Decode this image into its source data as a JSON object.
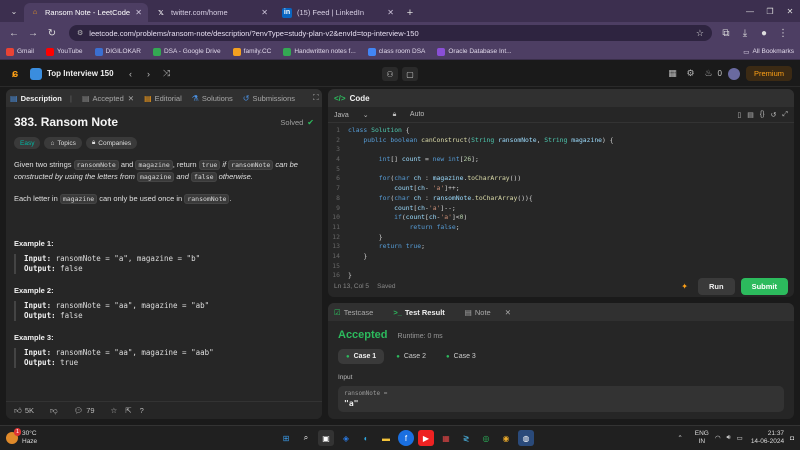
{
  "browser": {
    "tabs": [
      {
        "title": "Ransom Note - LeetCode",
        "favicon": "leetcode-icon",
        "active": true
      },
      {
        "title": "twitter.com/home",
        "favicon": "x-icon",
        "active": false
      },
      {
        "title": "(15) Feed | LinkedIn",
        "favicon": "linkedin-icon",
        "active": false
      }
    ],
    "url": "leetcode.com/problems/ransom-note/description/?envType=study-plan-v2&envId=top-interview-150",
    "bookmarks": [
      "Gmail",
      "YouTube",
      "DIGILOKAR",
      "DSA - Google Drive",
      "family.CC",
      "Handwritten notes f...",
      "class room DSA",
      "Oracle Database Int..."
    ],
    "all_bookmarks": "All Bookmarks"
  },
  "lc_nav": {
    "plan_title": "Top Interview 150",
    "fire_count": "0",
    "premium": "Premium"
  },
  "left": {
    "tabs": [
      "Description",
      "Accepted",
      "Editorial",
      "Solutions",
      "Submissions"
    ],
    "title": "383. Ransom Note",
    "solved": "Solved",
    "chips": [
      "Easy",
      "Topics",
      "Companies"
    ],
    "p1": {
      "a": "Given two strings ",
      "b": "ransomNote",
      "c": " and ",
      "d": "magazine",
      "e": ", return ",
      "f": "true",
      "g": " if ",
      "h": "ransomNote",
      "i": " can be constructed by using the letters from ",
      "j": "magazine",
      "k": " and ",
      "l": "false",
      "m": " otherwise."
    },
    "p2": {
      "a": "Each letter in ",
      "b": "magazine",
      "c": " can only be used once in ",
      "d": "ransomNote",
      "e": "."
    },
    "examples": [
      {
        "title": "Example 1:",
        "input_label": "Input:",
        "input": "ransomNote = \"a\", magazine = \"b\"",
        "output_label": "Output:",
        "output": "false"
      },
      {
        "title": "Example 2:",
        "input_label": "Input:",
        "input": "ransomNote = \"aa\", magazine = \"ab\"",
        "output_label": "Output:",
        "output": "false"
      },
      {
        "title": "Example 3:",
        "input_label": "Input:",
        "input": "ransomNote = \"aa\", magazine = \"aab\"",
        "output_label": "Output:",
        "output": "true"
      }
    ],
    "footer": {
      "likes": "5K",
      "comments": "79"
    }
  },
  "code": {
    "header": "Code",
    "language": "Java",
    "auto": "Auto",
    "status": "Ln 13, Col 5",
    "saved": "Saved",
    "run": "Run",
    "submit": "Submit"
  },
  "result": {
    "tabs": [
      "Testcase",
      "Test Result",
      "Note"
    ],
    "verdict": "Accepted",
    "runtime": "Runtime: 0 ms",
    "cases": [
      "Case 1",
      "Case 2",
      "Case 3"
    ],
    "input_label": "Input",
    "input_key": "ransomNote =",
    "input_value": "\"a\""
  },
  "taskbar": {
    "temp": "30°C",
    "weather": "Haze",
    "lang": "ENG",
    "region": "IN",
    "time": "21:37",
    "date": "14-06-2024",
    "weather_badge": "1"
  }
}
